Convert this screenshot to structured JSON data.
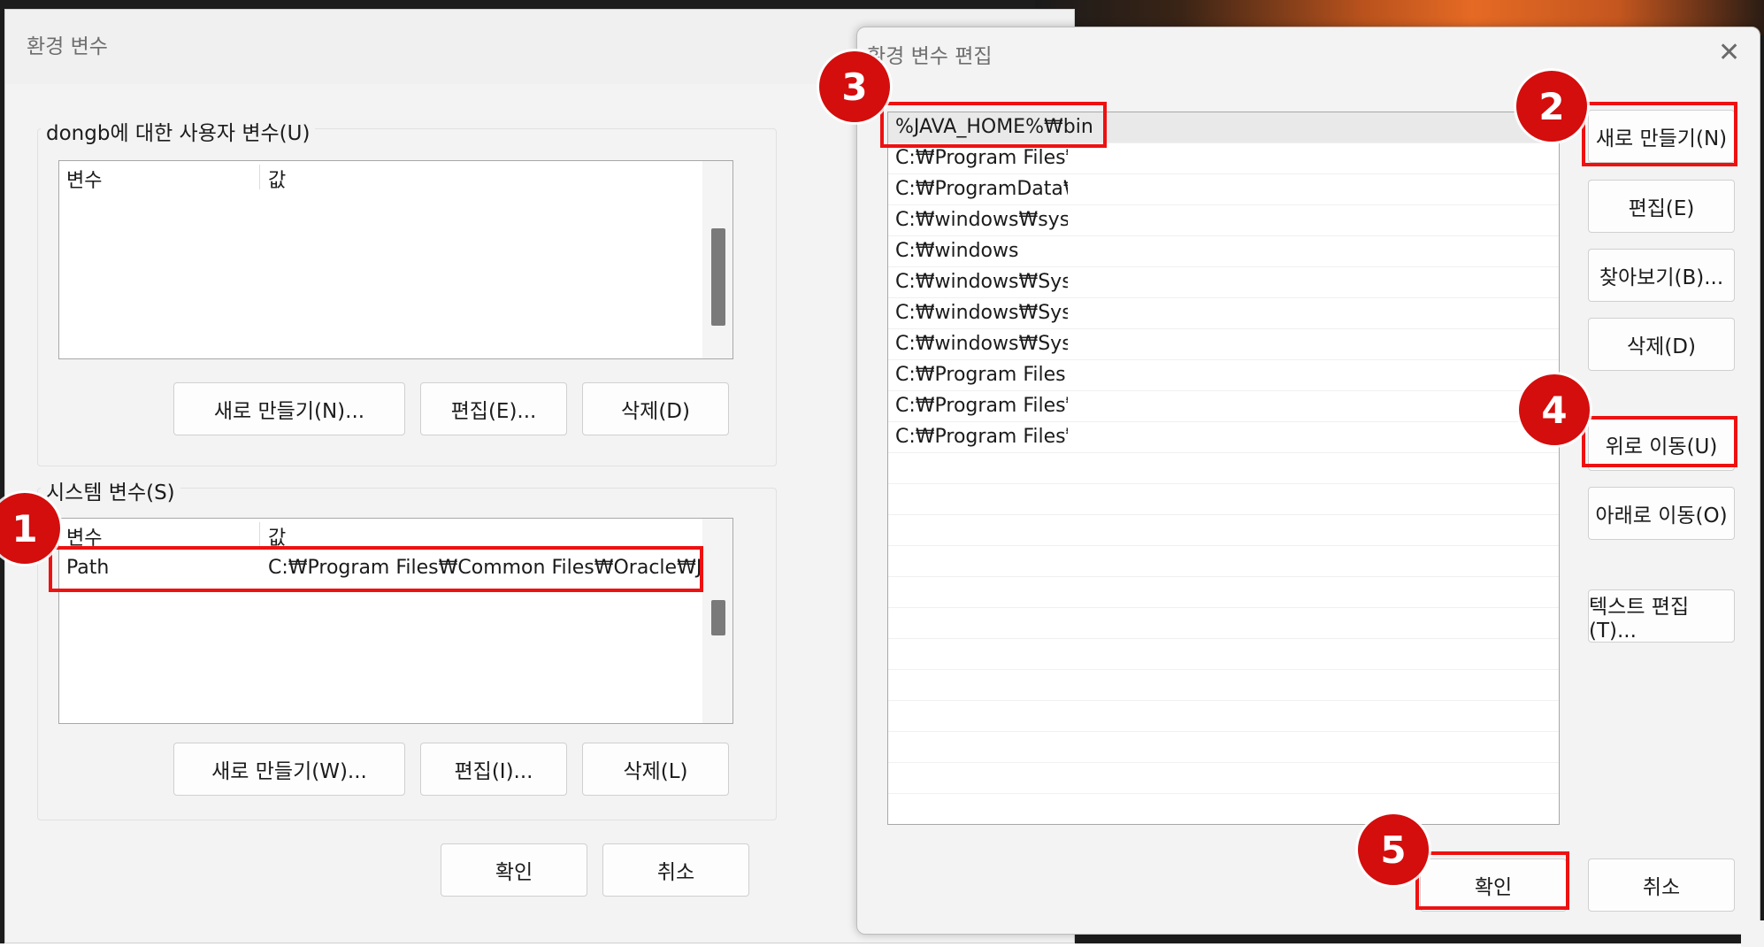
{
  "env_dialog": {
    "title": "환경 변수",
    "user_group_label": "dongb에 대한 사용자 변수(U)",
    "system_group_label": "시스템 변수(S)",
    "col_variable": "변수",
    "col_value": "값",
    "system_rows": [
      {
        "variable": "Path",
        "value": "C:₩Program Files₩Common Files₩Oracle₩Ja..."
      }
    ],
    "user_buttons": {
      "new": "새로 만들기(N)...",
      "edit": "편집(E)...",
      "delete": "삭제(D)"
    },
    "system_buttons": {
      "new": "새로 만들기(W)...",
      "edit": "편집(I)...",
      "delete": "삭제(L)"
    },
    "ok": "확인",
    "cancel": "취소"
  },
  "edit_dialog": {
    "title": "환경 변수 편집",
    "entries": [
      "%JAVA_HOME%₩bin",
      "C:₩Program Files₩",
      "C:₩ProgramData₩",
      "C:₩windows₩syste",
      "C:₩windows",
      "C:₩windows₩Syste",
      "C:₩windows₩Syste",
      "C:₩windows₩Syste",
      "C:₩Program Files (",
      "C:₩Program Files₩",
      "C:₩Program Files₩"
    ],
    "buttons": {
      "new": "새로 만들기(N)",
      "edit": "편집(E)",
      "browse": "찾아보기(B)...",
      "delete": "삭제(D)",
      "move_up": "위로 이동(U)",
      "move_down": "아래로 이동(O)",
      "edit_text": "텍스트 편집(T)..."
    },
    "ok": "확인",
    "cancel": "취소"
  },
  "annotations": {
    "color": "#ee1111",
    "badges": [
      "1",
      "2",
      "3",
      "4",
      "5"
    ]
  },
  "icons": {
    "close": "close-icon"
  }
}
